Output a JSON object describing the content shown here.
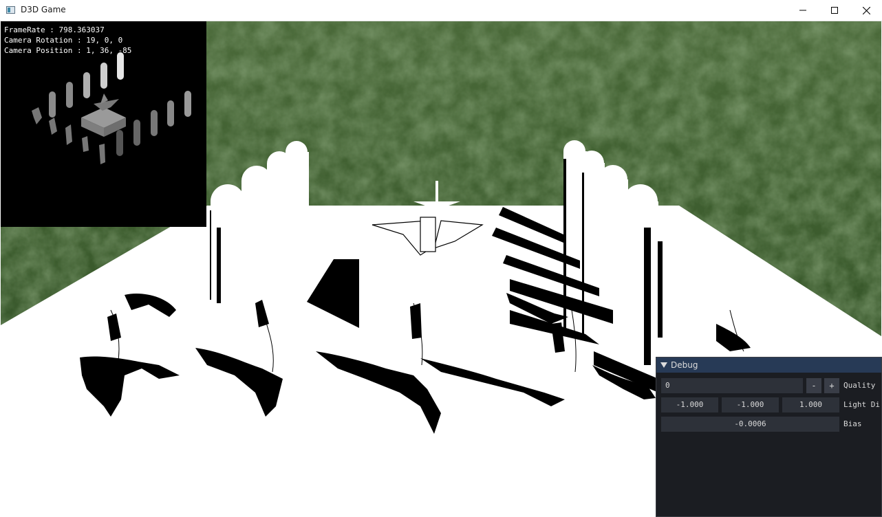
{
  "window": {
    "title": "D3D Game",
    "minimize_icon": "minimize-icon",
    "maximize_icon": "maximize-icon",
    "close_icon": "close-icon"
  },
  "hud": {
    "framerate": "FrameRate : 798.363037",
    "camera_rotation": "Camera Rotation : 19, 0, 0",
    "camera_position": "Camera Position : 1, 36, -85"
  },
  "debug": {
    "title": "Debug",
    "quality": {
      "value": "0",
      "minus_label": "-",
      "plus_label": "+",
      "label": "Quality"
    },
    "light_dir": {
      "x": "-1.000",
      "y": "-1.000",
      "z": "1.000",
      "label": "Light Di"
    },
    "bias": {
      "value": "-0.0006",
      "label": "Bias"
    }
  },
  "colors": {
    "terrain_green": "#3d5a2c",
    "debug_bg": "#1b1d22",
    "debug_title_bg": "#273a56",
    "field_bg": "#2d3139"
  }
}
